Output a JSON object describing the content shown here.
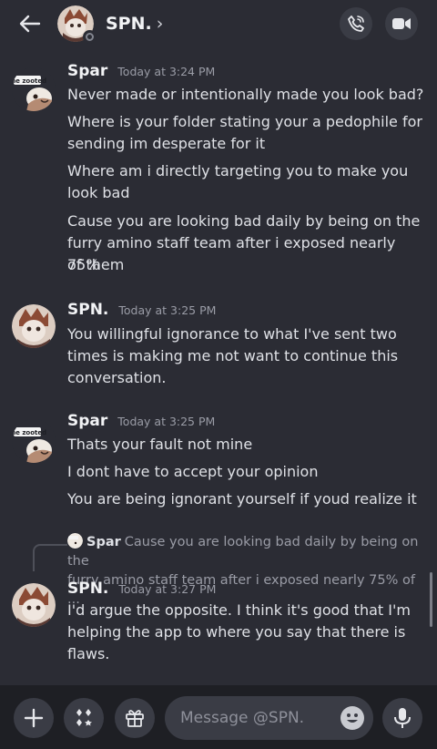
{
  "header": {
    "title": "SPN.",
    "chevron": "›",
    "icons": {
      "back": "back-arrow-icon",
      "call": "phone-call-icon",
      "video": "video-camera-icon"
    }
  },
  "messages": [
    {
      "author": "Spar",
      "timestamp": "Today at 3:24 PM",
      "avatar_tag": "the zooted",
      "lines": [
        "Never made or intentionally made you look bad?",
        "Where is your folder stating your a pedophile for",
        "sending im desperate for it",
        "Where am i directly targeting you to make you",
        "look bad",
        "Cause you are looking bad daily by being on the",
        "furry amino staff team after i exposed nearly 75%",
        "of them"
      ]
    },
    {
      "author": "SPN.",
      "timestamp": "Today at 3:25 PM",
      "lines": [
        "You willingful ignorance to what I've sent two",
        "times is making me not want to continue this",
        "conversation."
      ]
    },
    {
      "author": "Spar",
      "timestamp": "Today at 3:25 PM",
      "avatar_tag": "the zooted",
      "lines": [
        "Thats your fault not mine",
        "I dont have to accept your opinion",
        "You are being ignorant yourself if youd realize it"
      ]
    },
    {
      "author": "SPN.",
      "timestamp": "Today at 3:27 PM",
      "reply": {
        "author": "Spar",
        "text_line1": "Cause you are looking bad daily by being on the",
        "text_line2": "furry amino staff team after i exposed nearly 75% of ..."
      },
      "lines": [
        "I'd argue the opposite. I think it's good that I'm",
        "helping the app to where you say that there is",
        "flaws."
      ]
    }
  ],
  "composer": {
    "placeholder": "Message @SPN.",
    "icons": {
      "plus": "plus-icon",
      "apps": "apps-icon",
      "gift": "gift-icon",
      "emoji": "emoji-icon",
      "mic": "microphone-icon"
    }
  }
}
